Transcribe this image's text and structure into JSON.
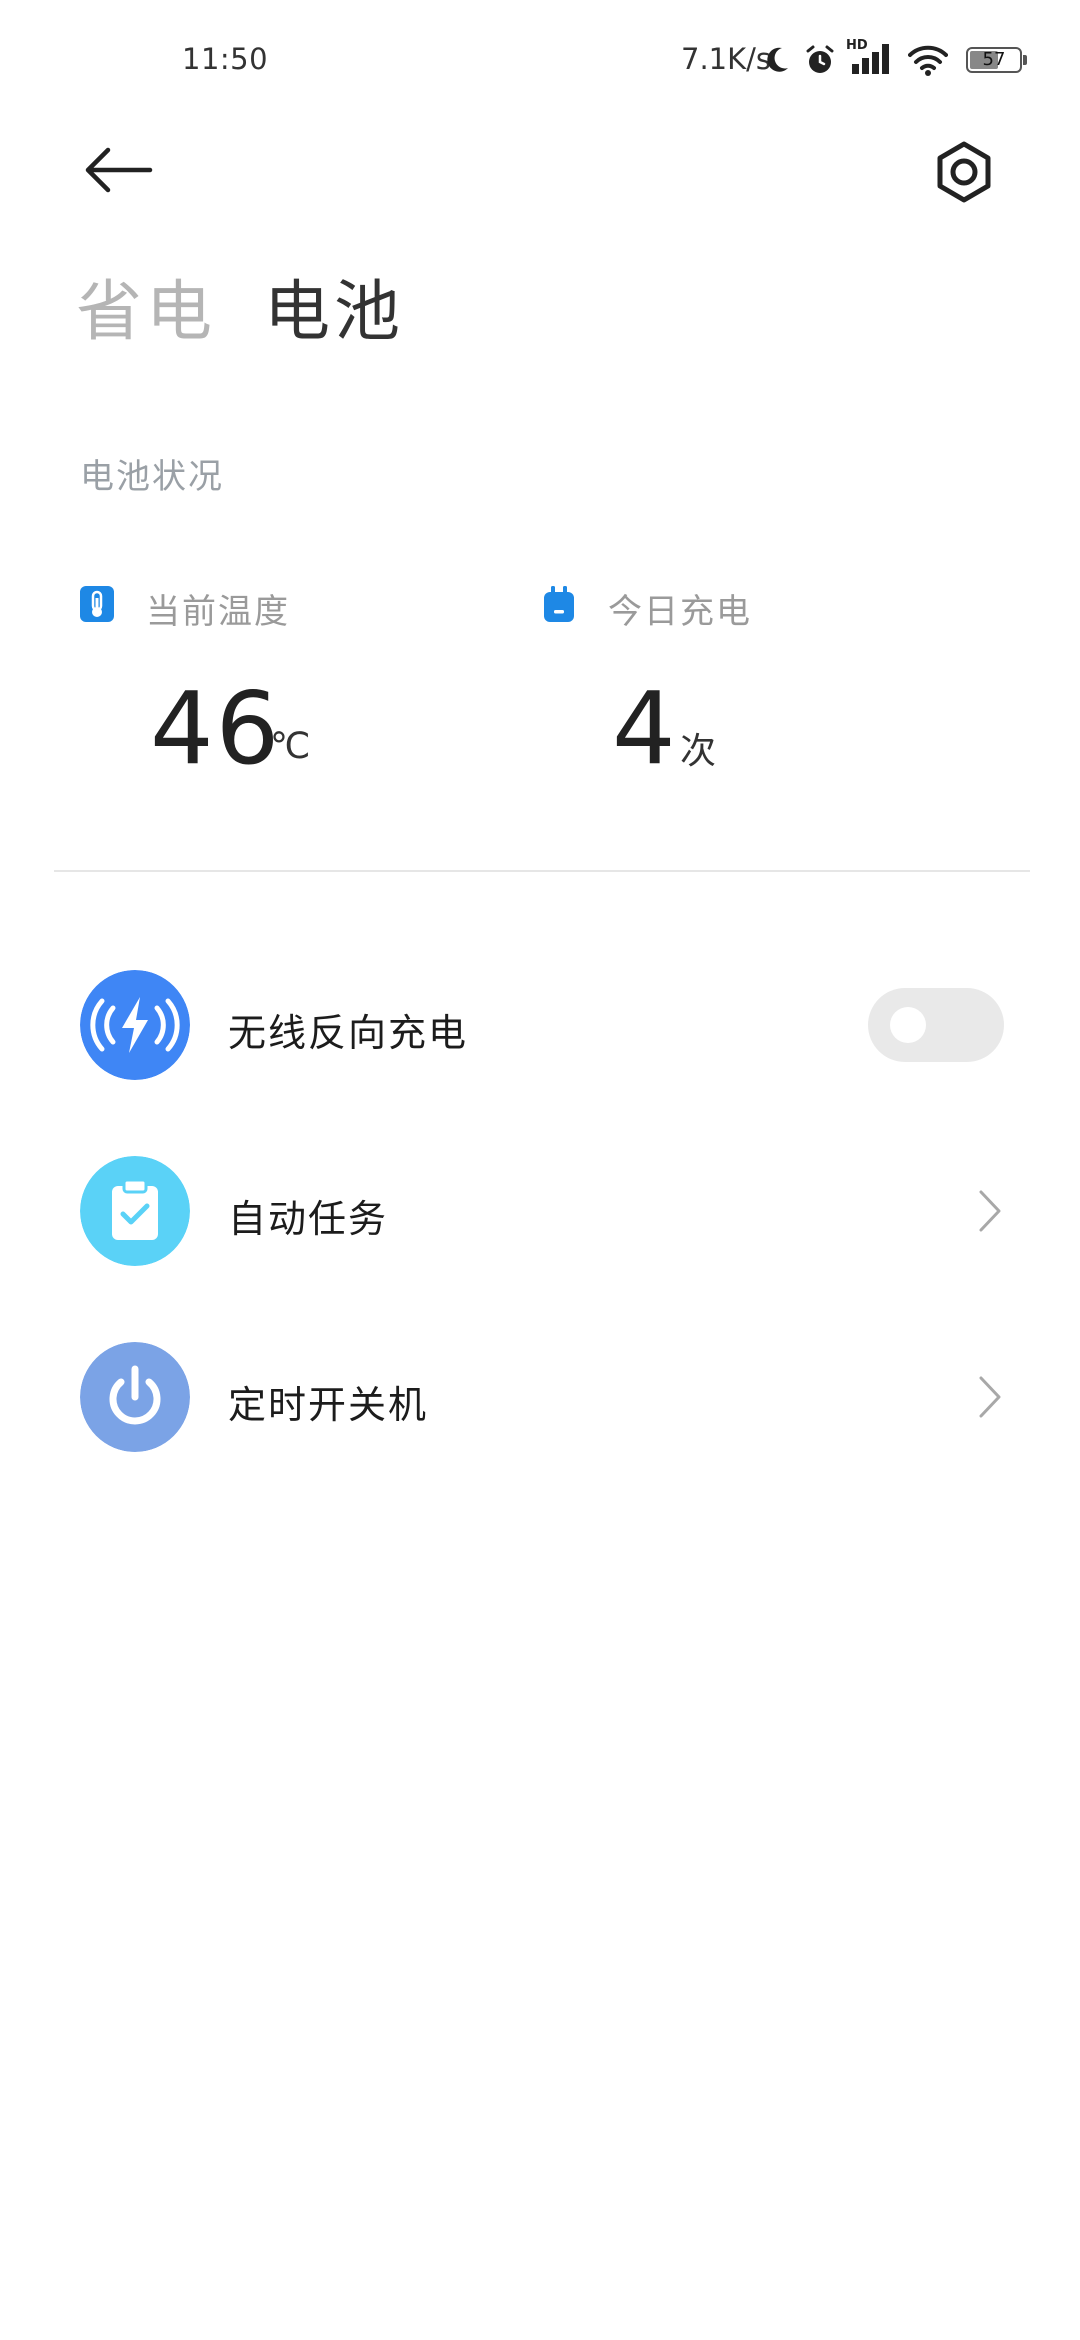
{
  "status_bar": {
    "time": "11:50",
    "net_speed": "7.1K/s",
    "icons": [
      "moon-icon",
      "alarm-icon",
      "hd-signal-icon",
      "wifi-icon",
      "battery-icon"
    ],
    "hd_label": "HD",
    "battery_level": "57"
  },
  "header": {
    "tabs": [
      {
        "label": "省电",
        "active": false
      },
      {
        "label": "电池",
        "active": true
      }
    ]
  },
  "battery_status": {
    "section_title": "电池状况",
    "temperature": {
      "label": "当前温度",
      "value": "46",
      "unit": "℃",
      "icon": "thermometer-icon"
    },
    "charges_today": {
      "label": "今日充电",
      "value": "4",
      "unit": "次",
      "icon": "plug-icon"
    }
  },
  "list": {
    "items": [
      {
        "label": "无线反向充电",
        "icon": "wireless-charging-icon",
        "color": "#3f86f5",
        "control": "toggle",
        "toggle_on": false
      },
      {
        "label": "自动任务",
        "icon": "clipboard-check-icon",
        "color": "#5ad2f7",
        "control": "chevron"
      },
      {
        "label": "定时开关机",
        "icon": "power-icon",
        "color": "#7ba3e6",
        "control": "chevron"
      }
    ]
  },
  "colors": {
    "accent_blue": "#1e88e5",
    "text_primary": "#1c1c1c",
    "text_secondary": "#9a9a9a"
  }
}
